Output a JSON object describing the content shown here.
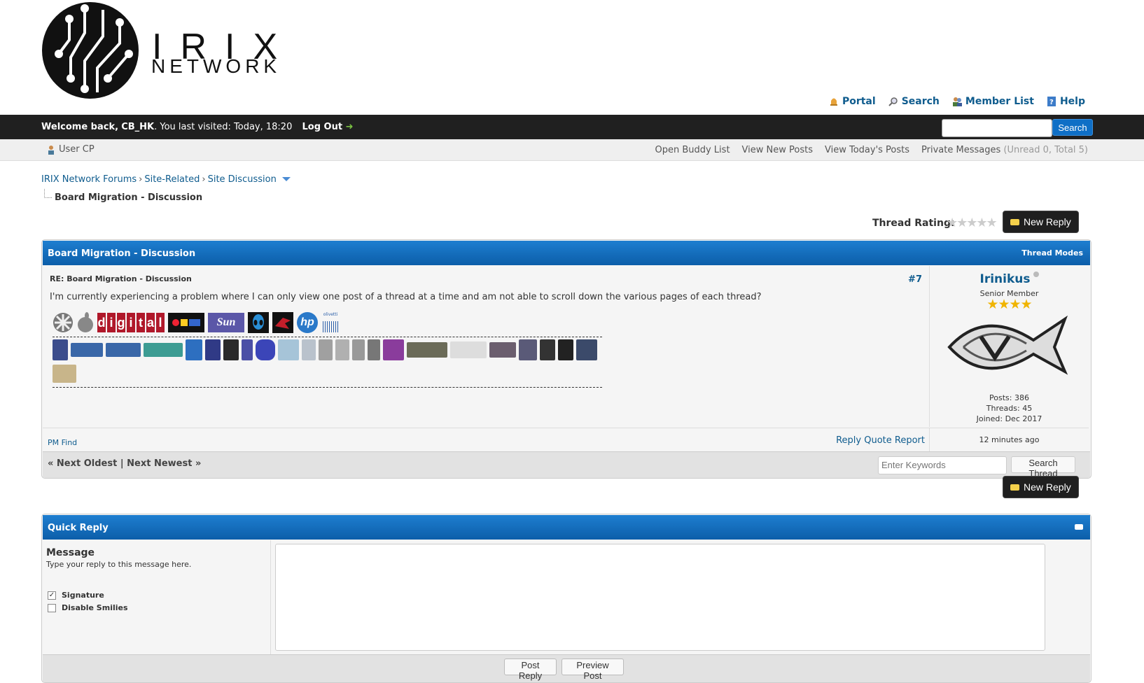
{
  "brand": {
    "title": "IRIX",
    "subtitle": "NETWORK"
  },
  "toplinks": [
    {
      "label": "Portal",
      "icon": "bell-icon"
    },
    {
      "label": "Search",
      "icon": "magnifier-icon"
    },
    {
      "label": "Member List",
      "icon": "members-icon"
    },
    {
      "label": "Help",
      "icon": "help-icon"
    }
  ],
  "welcome": {
    "prefix": "Welcome back,",
    "username": "CB_HK",
    "visited": ". You last visited: Today, 18:20",
    "logout": "Log Out"
  },
  "top_search": {
    "placeholder": "",
    "button": "Search"
  },
  "panel": {
    "usercp": "User CP",
    "links": [
      "Open Buddy List",
      "View New Posts",
      "View Today's Posts"
    ],
    "pm_label": "Private Messages",
    "pm_counts": "(Unread 0, Total 5)"
  },
  "breadcrumb": {
    "items": [
      "IRIX Network Forums",
      "Site-Related",
      "Site Discussion"
    ],
    "current": "Board Migration - Discussion"
  },
  "thread_rating_label": "Thread Rating:",
  "new_reply": "New Reply",
  "thread": {
    "title": "Board Migration - Discussion",
    "modes": "Thread Modes",
    "post": {
      "subject": "RE: Board Migration - Discussion",
      "number": "#7",
      "body": "I'm currently experiencing a problem where I can only view one post of a thread at a time and am not able to scroll down the various pages of each thread?",
      "sig_logos": [
        "sgi-cube-logo",
        "apple-logo",
        "digital-logo",
        "pdp-logo",
        "sun-logo",
        "alienware-logo",
        "rog-logo",
        "hp-logo",
        "olivetti-logo"
      ],
      "sig_logo_text": {
        "digital": "digital",
        "sun": "Sun",
        "hp": "hp",
        "olivetti": "olivetti"
      },
      "footer_left": "PM Find",
      "footer_right": "Reply Quote Report"
    },
    "author": {
      "name": "Irinikus",
      "rank": "Senior Member",
      "stars": "★★★★",
      "posts": "Posts: 386",
      "threads": "Threads: 45",
      "joined": "Joined: Dec 2017",
      "time": "12 minutes ago"
    },
    "nav": "« Next Oldest | Next Newest »",
    "keywords_placeholder": "Enter Keywords",
    "search_thread": "Search Thread"
  },
  "quick_reply": {
    "title": "Quick Reply",
    "message_label": "Message",
    "hint": "Type your reply to this message here.",
    "signature": "Signature",
    "disable_smilies": "Disable Smilies",
    "post_reply": "Post Reply",
    "preview_post": "Preview Post"
  }
}
